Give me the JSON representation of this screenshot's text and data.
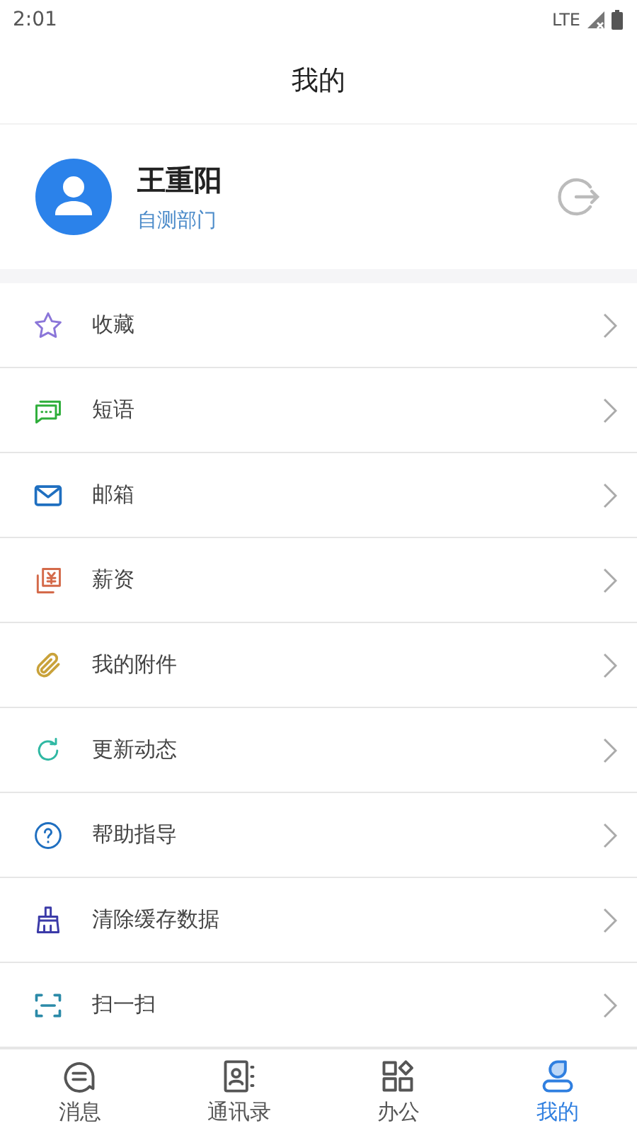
{
  "status_bar": {
    "time": "2:01",
    "network": "LTE"
  },
  "header": {
    "title": "我的"
  },
  "profile": {
    "name": "王重阳",
    "department": "自测部门"
  },
  "menu": [
    {
      "label": "收藏"
    },
    {
      "label": "短语"
    },
    {
      "label": "邮箱"
    },
    {
      "label": "薪资"
    },
    {
      "label": "我的附件"
    },
    {
      "label": "更新动态"
    },
    {
      "label": "帮助指导"
    },
    {
      "label": "清除缓存数据"
    },
    {
      "label": "扫一扫"
    }
  ],
  "tab_bar": [
    {
      "label": "消息",
      "selected": false
    },
    {
      "label": "通讯录",
      "selected": false
    },
    {
      "label": "办公",
      "selected": false
    },
    {
      "label": "我的",
      "selected": true
    }
  ]
}
